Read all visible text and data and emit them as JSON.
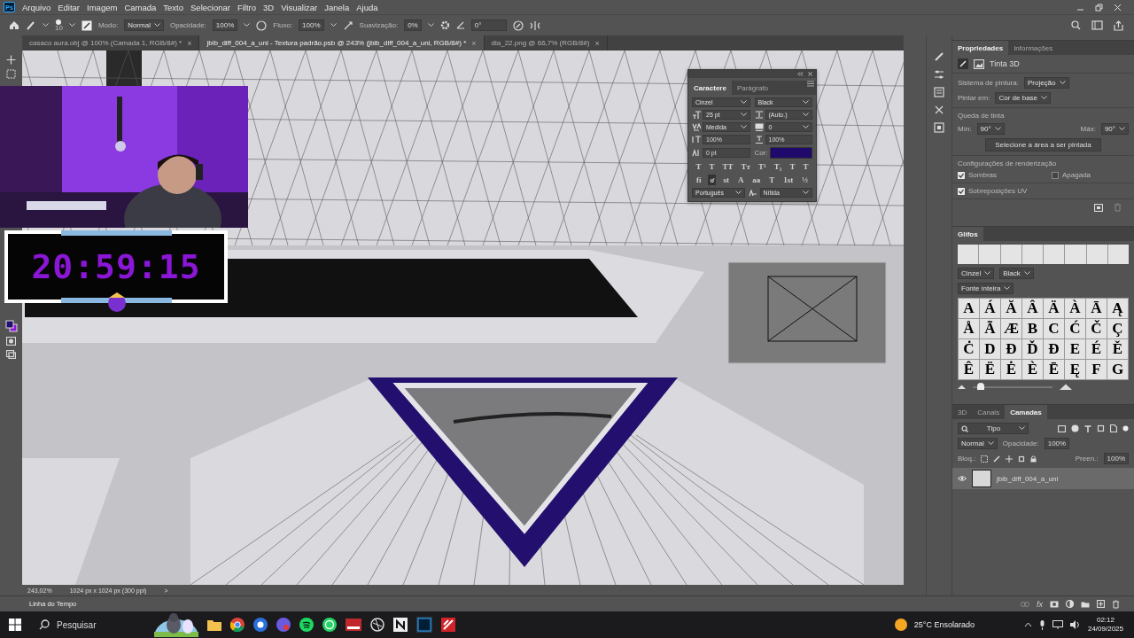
{
  "menu_bar": {
    "logo": "Ps",
    "items": [
      "Arquivo",
      "Editar",
      "Imagem",
      "Camada",
      "Texto",
      "Selecionar",
      "Filtro",
      "3D",
      "Visualizar",
      "Janela",
      "Ajuda"
    ]
  },
  "options_bar": {
    "brush_size": "10",
    "mode_label": "Modo:",
    "mode": "Normal",
    "opacity_label": "Opacidade:",
    "opacity": "100%",
    "flow_label": "Fluxo:",
    "flow": "100%",
    "smoothing_label": "Suavização:",
    "smoothing": "0%",
    "angle": "0°"
  },
  "document_tabs": [
    {
      "title": "casaco aura.obj @ 100% (Camada 1, RGB/8#) *",
      "selected": false,
      "close": "×"
    },
    {
      "title": "jbib_diff_004_a_uni - Textura padrão.psb @ 243% (jbib_diff_004_a_uni, RGB/8#) *",
      "selected": true,
      "close": "×"
    },
    {
      "title": "dia_22.png @ 66,7% (RGB/8#)",
      "selected": false,
      "close": "×"
    }
  ],
  "stream_overlay": {
    "timer": "20:59:15"
  },
  "character_panel": {
    "tabs": [
      {
        "label": "Caractere",
        "selected": true
      },
      {
        "label": "Parágrafo",
        "selected": false
      }
    ],
    "font": "Cinzel",
    "style": "Black",
    "size": "25 pt",
    "leading": "(Auto.)",
    "kerning": "Medida",
    "tracking": "0",
    "vertical_scale": "100%",
    "horizontal_scale": "100%",
    "baseline_shift": "0 pt",
    "color_label": "Cor:",
    "color": "#1f0a6b",
    "style_buttons": [
      "T",
      "T",
      "TT",
      "Tт",
      "T¹",
      "T₁",
      "T",
      "T"
    ],
    "opentype_buttons": [
      {
        "label": "fi",
        "selected": false
      },
      {
        "label": "ơ",
        "selected": true
      },
      {
        "label": "st",
        "selected": false
      },
      {
        "label": "A",
        "selected": false
      },
      {
        "label": "aa",
        "selected": false
      },
      {
        "label": "T",
        "selected": false
      },
      {
        "label": "1st",
        "selected": false
      },
      {
        "label": "½",
        "selected": false
      }
    ],
    "language": "Português",
    "antialias": "Nítida"
  },
  "properties_panel": {
    "tabs": [
      {
        "label": "Propriedades",
        "selected": true
      },
      {
        "label": "Informações",
        "selected": false
      }
    ],
    "title": "Tinta 3D",
    "paint_system_label": "Sistema de pintura:",
    "paint_system": "Projeção",
    "paint_on_label": "Pintar em:",
    "paint_on": "Cor de base",
    "falloff_title": "Queda de tinta",
    "min_label": "Mín:",
    "min": "90°",
    "max_label": "Máx:",
    "max": "90°",
    "select_button": "Selecione a área a ser pintada",
    "render_title": "Configurações de renderização",
    "checkboxes": [
      {
        "label": "Sombras",
        "checked": true
      },
      {
        "label": "Apagada",
        "checked": false
      },
      {
        "label": "Sobreposições UV",
        "checked": true
      }
    ]
  },
  "glyphs_panel": {
    "tab": "Glifos",
    "font": "Cinzel",
    "style": "Black",
    "filter": "Fonte inteira",
    "glyphs": [
      "A",
      "Á",
      "Ă",
      "Â",
      "Ä",
      "À",
      "Ā",
      "Ą",
      "Å",
      "Ã",
      "Æ",
      "B",
      "C",
      "Ć",
      "Č",
      "Ç",
      "Ċ",
      "D",
      "Đ",
      "Ď",
      "Đ",
      "E",
      "É",
      "Ě",
      "Ê",
      "Ë",
      "Ė",
      "È",
      "Ē",
      "Ę",
      "F",
      "G"
    ],
    "size_slider": {
      "level": 0.1
    }
  },
  "layers_panel": {
    "tabs": [
      {
        "label": "3D",
        "selected": false
      },
      {
        "label": "Canais",
        "selected": false
      },
      {
        "label": "Camadas",
        "selected": true
      }
    ],
    "filter": "Tipo",
    "blend_mode": "Normal",
    "opacity_label": "Opacidade:",
    "opacity": "100%",
    "lock_label": "Bloq.:",
    "fill_label": "Preen.:",
    "fill": "100%",
    "layers": [
      {
        "name": "jbib_diff_004_a_uni",
        "visible": true
      }
    ],
    "footer_fx": "fx"
  },
  "status_bar": {
    "zoom": "243,02%",
    "doc_size": "1024 px x 1024 px (300 ppi)",
    "arrow": ">"
  },
  "timeline": {
    "title": "Linha do Tempo"
  },
  "taskbar": {
    "search": "Pesquisar",
    "weather": "25°C Ensolarado",
    "time": "02:12",
    "date": "24/09/2025"
  }
}
